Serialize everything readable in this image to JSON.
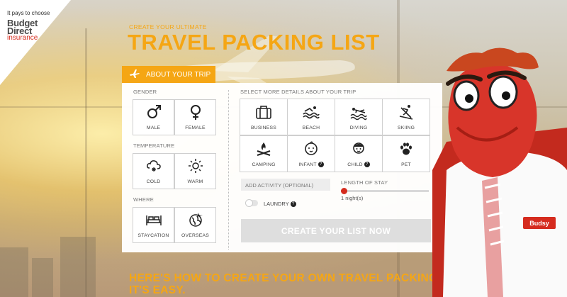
{
  "brand": {
    "tagline": "It pays to choose",
    "name_part1": "Budget",
    "name_part2": "Direct",
    "name_part3": "insurance"
  },
  "header": {
    "subtitle": "CREATE YOUR ULTIMATE",
    "title": "TRAVEL PACKING LIST"
  },
  "tab": {
    "label": "ABOUT YOUR TRIP",
    "icon": "airplane-icon"
  },
  "gender": {
    "label": "GENDER",
    "options": [
      {
        "label": "MALE",
        "icon": "male-icon"
      },
      {
        "label": "FEMALE",
        "icon": "female-icon"
      }
    ]
  },
  "temperature": {
    "label": "TEMPERATURE",
    "options": [
      {
        "label": "COLD",
        "icon": "cold-icon"
      },
      {
        "label": "WARM",
        "icon": "sun-icon"
      }
    ]
  },
  "where": {
    "label": "WHERE",
    "options": [
      {
        "label": "STAYCATION",
        "icon": "bed-icon"
      },
      {
        "label": "OVERSEAS",
        "icon": "globe-icon"
      }
    ]
  },
  "details": {
    "label": "SELECT MORE DETAILS ABOUT YOUR TRIP",
    "options": [
      {
        "label": "BUSINESS",
        "icon": "briefcase-icon"
      },
      {
        "label": "BEACH",
        "icon": "waves-icon"
      },
      {
        "label": "DIVING",
        "icon": "diver-icon"
      },
      {
        "label": "SKIING",
        "icon": "skier-icon"
      },
      {
        "label": "CAMPING",
        "icon": "campfire-icon"
      },
      {
        "label": "INFANT",
        "icon": "baby-icon"
      },
      {
        "label": "CHILD",
        "icon": "child-icon"
      },
      {
        "label": "PET",
        "icon": "paw-icon"
      }
    ],
    "help_glyph": "?"
  },
  "activity": {
    "placeholder": "ADD ACTIVITY (OPTIONAL)",
    "laundry_label": "LAUNDRY"
  },
  "stay": {
    "label": "LENGTH OF STAY",
    "value_text": "1 night(s)",
    "value": 1
  },
  "cta": {
    "label": "CREATE YOUR LIST NOW"
  },
  "howto": {
    "line1": "HERE'S HOW TO CREATE YOUR OWN TRAVEL PACKING LIST.",
    "line2": "IT'S EASY."
  },
  "mascot": {
    "badge": "Budsy"
  },
  "colors": {
    "accent": "#f5a614",
    "brand_red": "#d52b1e"
  }
}
